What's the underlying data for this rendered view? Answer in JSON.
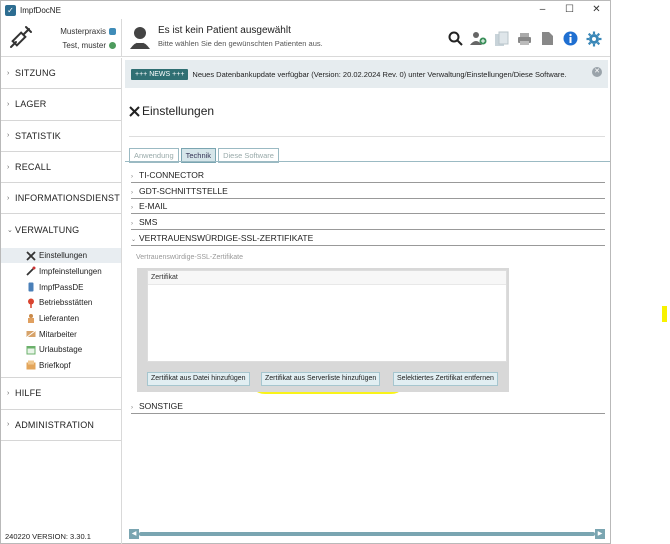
{
  "window": {
    "title": "ImpfDocNE",
    "controls": [
      "–",
      "☐",
      "✕"
    ]
  },
  "header": {
    "practice_name": "Musterpraxis",
    "user_name": "Test, muster",
    "patient_title": "Es ist kein Patient ausgewählt",
    "patient_subtitle": "Bitte wählen Sie den gewünschten Patienten aus."
  },
  "sidebar": {
    "sections": [
      {
        "label": "SITZUNG"
      },
      {
        "label": "LAGER"
      },
      {
        "label": "STATISTIK"
      },
      {
        "label": "RECALL"
      },
      {
        "label": "INFORMATIONSDIENST"
      },
      {
        "label": "VERWALTUNG"
      },
      {
        "label": "HILFE"
      },
      {
        "label": "ADMINISTRATION"
      }
    ],
    "verwaltung_items": [
      {
        "label": "Einstellungen",
        "icon": "tools-icon"
      },
      {
        "label": "Impfeinstellungen",
        "icon": "syringe-icon"
      },
      {
        "label": "ImpfPassDE",
        "icon": "phone-icon"
      },
      {
        "label": "Betriebsstätten",
        "icon": "pin-icon"
      },
      {
        "label": "Lieferanten",
        "icon": "delivery-icon"
      },
      {
        "label": "Mitarbeiter",
        "icon": "staff-icon"
      },
      {
        "label": "Urlaubstage",
        "icon": "calendar-icon"
      },
      {
        "label": "Briefkopf",
        "icon": "letterhead-icon"
      }
    ],
    "version": "240220 VERSION: 3.30.1"
  },
  "news": {
    "badge": "+++ NEWS +++",
    "text": "Neues Datenbankupdate verfügbar (Version: 20.02.2024 Rev. 0) unter Verwaltung/Einstellungen/Diese Software."
  },
  "settings": {
    "title": "Einstellungen",
    "tabs": [
      "Anwendung",
      "Technik",
      "Diese Software"
    ],
    "accordion": [
      "TI-CONNECTOR",
      "GDT-SCHNITTSTELLE",
      "E-MAIL",
      "SMS",
      "VERTRAUENSWÜRDIGE-SSL-ZERTIFIKATE",
      "SONSTIGE"
    ],
    "ssl_section_label": "Vertrauenswürdige-SSL-Zertifikate",
    "table_header": "Zertifikat",
    "buttons": {
      "add_from_file": "Zertifikat aus Datei hinzufügen",
      "add_from_server": "Zertifikat aus Serverliste hinzufügen",
      "remove_selected": "Selektiertes Zertifikat entfernen"
    }
  },
  "colors": {
    "accent": "#2f6f73",
    "highlight": "#f8f200",
    "button_bg": "#e1eef2"
  }
}
